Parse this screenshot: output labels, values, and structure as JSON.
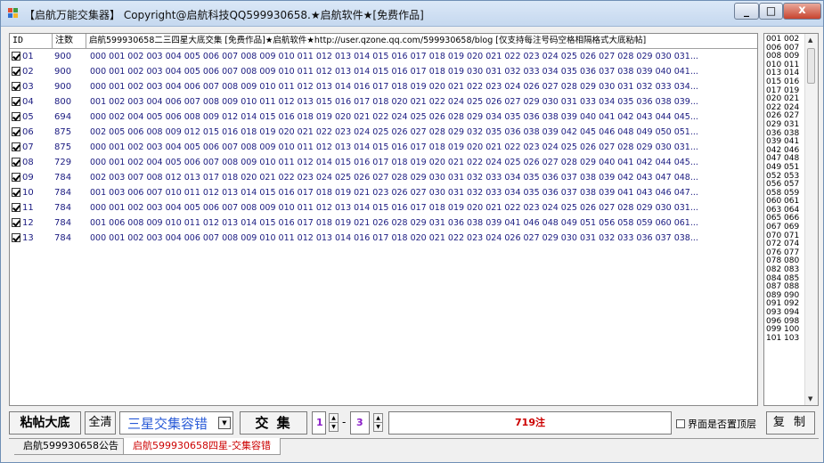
{
  "window": {
    "title": "【启航万能交集器】 Copyright@启航科技QQ599930658.★启航软件★[免费作品]",
    "minimize": "_",
    "maximize": "□",
    "close": "x"
  },
  "grid": {
    "headers": {
      "id": "ID",
      "count": "注数",
      "data": "启航599930658二三四星大底交集 [免费作品]★启航软件★http://user.qzone.qq.com/599930658/blog [仅支持每注号码空格相隔格式大底粘帖]"
    },
    "rows": [
      {
        "id": "01",
        "count": "900",
        "nums": "000 001 002 003 004 005 006 007 008 009 010 011 012 013 014 015 016 017 018 019 020 021 022 023 024 025 026 027 028 029 030 031..."
      },
      {
        "id": "02",
        "count": "900",
        "nums": "000 001 002 003 004 005 006 007 008 009 010 011 012 013 014 015 016 017 018 019 030 031 032 033 034 035 036 037 038 039 040 041..."
      },
      {
        "id": "03",
        "count": "900",
        "nums": "000 001 002 003 004 006 007 008 009 010 011 012 013 014 016 017 018 019 020 021 022 023 024 026 027 028 029 030 031 032 033 034..."
      },
      {
        "id": "04",
        "count": "800",
        "nums": "001 002 003 004 006 007 008 009 010 011 012 013 015 016 017 018 020 021 022 024 025 026 027 029 030 031 033 034 035 036 038 039..."
      },
      {
        "id": "05",
        "count": "694",
        "nums": "000 002 004 005 006 008 009 012 014 015 016 018 019 020 021 022 024 025 026 028 029 034 035 036 038 039 040 041 042 043 044 045..."
      },
      {
        "id": "06",
        "count": "875",
        "nums": "002 005 006 008 009 012 015 016 018 019 020 021 022 023 024 025 026 027 028 029 032 035 036 038 039 042 045 046 048 049 050 051..."
      },
      {
        "id": "07",
        "count": "875",
        "nums": "000 001 002 003 004 005 006 007 008 009 010 011 012 013 014 015 016 017 018 019 020 021 022 023 024 025 026 027 028 029 030 031..."
      },
      {
        "id": "08",
        "count": "729",
        "nums": "000 001 002 004 005 006 007 008 009 010 011 012 014 015 016 017 018 019 020 021 022 024 025 026 027 028 029 040 041 042 044 045..."
      },
      {
        "id": "09",
        "count": "784",
        "nums": "002 003 007 008 012 013 017 018 020 021 022 023 024 025 026 027 028 029 030 031 032 033 034 035 036 037 038 039 042 043 047 048..."
      },
      {
        "id": "10",
        "count": "784",
        "nums": "001 003 006 007 010 011 012 013 014 015 016 017 018 019 021 023 026 027 030 031 032 033 034 035 036 037 038 039 041 043 046 047..."
      },
      {
        "id": "11",
        "count": "784",
        "nums": "000 001 002 003 004 005 006 007 008 009 010 011 012 013 014 015 016 017 018 019 020 021 022 023 024 025 026 027 028 029 030 031..."
      },
      {
        "id": "12",
        "count": "784",
        "nums": "001 006 008 009 010 011 012 013 014 015 016 017 018 019 021 026 028 029 031 036 038 039 041 046 048 049 051 056 058 059 060 061..."
      },
      {
        "id": "13",
        "count": "784",
        "nums": "000 001 002 003 004 006 007 008 009 010 011 012 013 014 016 017 018 020 021 022 023 024 026 027 029 030 031 032 033 036 037 038..."
      }
    ]
  },
  "result_list": [
    "001 002",
    "006 007",
    "008 009",
    "010 011",
    "013 014",
    "015 016",
    "017 019",
    "020 021",
    "022 024",
    "026 027",
    "029 031",
    "036 038",
    "039 041",
    "042 046",
    "047 048",
    "049 051",
    "052 053",
    "056 057",
    "058 059",
    "060 061",
    "063 064",
    "065 066",
    "067 069",
    "070 071",
    "072 074",
    "076 077",
    "078 080",
    "082 083",
    "084 085",
    "087 088",
    "089 090",
    "091 092",
    "093 094",
    "096 098",
    "099 100",
    "101 103"
  ],
  "toolbar": {
    "paste_label": "粘帖大底",
    "clear_label": "全清",
    "mode_value": "三星交集容错",
    "cross_label": "交 集",
    "from_value": "1",
    "dash": "-",
    "to_value": "3",
    "result_text": "719注",
    "topmost_label": "界面是否置顶层",
    "copy_label": "复 制"
  },
  "tabs": [
    {
      "label": "启航599930658公告"
    },
    {
      "label": "启航599930658四星-交集容错"
    }
  ],
  "colors": {
    "data_text": "#1a1a80",
    "result_red": "#cc0000",
    "spin_purple": "#8a1ec8",
    "mode_blue": "#2a5bd7"
  }
}
